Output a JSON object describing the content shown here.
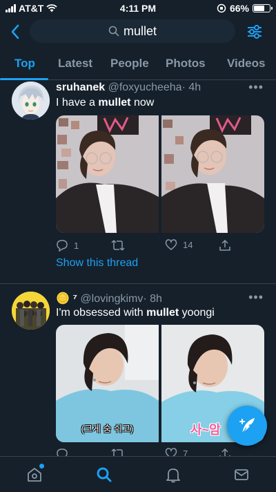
{
  "status_bar": {
    "carrier": "AT&T",
    "time": "4:11 PM",
    "battery": "66%",
    "battery_level": 0.66
  },
  "search": {
    "query": "mullet"
  },
  "tabs": [
    {
      "label": "Top",
      "active": true
    },
    {
      "label": "Latest"
    },
    {
      "label": "People"
    },
    {
      "label": "Photos"
    },
    {
      "label": "Videos"
    }
  ],
  "tweets": [
    {
      "name": "sruhanek",
      "handle": "@foxyucheeha",
      "time": "· 4h",
      "text_before": "I have a ",
      "text_bold": "mullet",
      "text_after": " now",
      "replies": "1",
      "retweets": "",
      "likes": "14",
      "thread_link": "Show this thread"
    },
    {
      "name": "🪙 ⁷",
      "handle": "@lovingkimv",
      "time": "· 8h",
      "text_before": "I'm obsessed with ",
      "text_bold": "mullet",
      "text_after": " yoongi",
      "likes": "7",
      "subtitle_1": "(크게 숨 쉬고)",
      "subtitle_2": "사~암"
    }
  ],
  "colors": {
    "background": "#15202b",
    "accent": "#1da1f2",
    "muted": "#8899a6",
    "border": "#38444d"
  },
  "icons": [
    "back-icon",
    "search-icon",
    "filter-icon",
    "more-icon",
    "reply-icon",
    "retweet-icon",
    "like-icon",
    "share-icon",
    "compose-icon",
    "home-icon",
    "explore-icon",
    "notifications-icon",
    "messages-icon"
  ]
}
